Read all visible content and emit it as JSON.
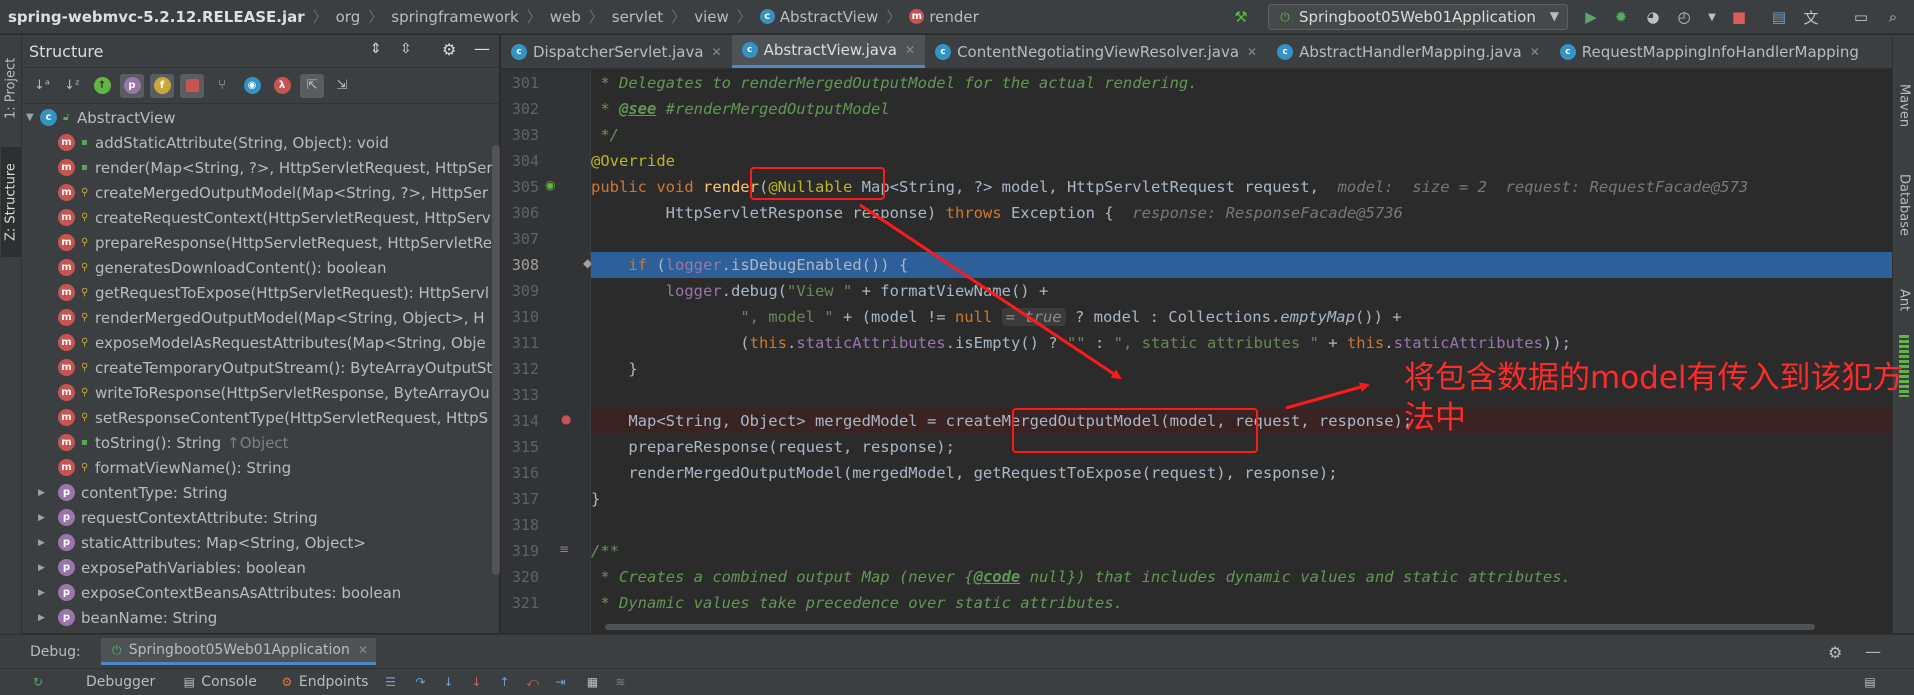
{
  "breadcrumbs": [
    {
      "label": "spring-webmvc-5.2.12.RELEASE.jar",
      "kind": "jar"
    },
    {
      "label": "org",
      "kind": "pkg"
    },
    {
      "label": "springframework",
      "kind": "pkg"
    },
    {
      "label": "web",
      "kind": "pkg"
    },
    {
      "label": "servlet",
      "kind": "pkg"
    },
    {
      "label": "view",
      "kind": "pkg"
    },
    {
      "label": "AbstractView",
      "kind": "class"
    },
    {
      "label": "render",
      "kind": "method"
    }
  ],
  "run_config": {
    "label": "Springboot05Web01Application"
  },
  "left_stripe": {
    "project": "1: Project",
    "structure": "Z: Structure"
  },
  "right_stripe": {
    "maven": "Maven",
    "database": "Database",
    "ant": "Ant"
  },
  "structure": {
    "title": "Structure",
    "root": "AbstractView",
    "members": [
      {
        "icon": "m",
        "vis": "pub",
        "text": "addStaticAttribute(String, Object): void"
      },
      {
        "icon": "m",
        "vis": "pub",
        "text": "render(Map<String, ?>, HttpServletRequest, HttpSer"
      },
      {
        "icon": "m",
        "vis": "prot",
        "text": "createMergedOutputModel(Map<String, ?>, HttpSer"
      },
      {
        "icon": "m",
        "vis": "prot",
        "text": "createRequestContext(HttpServletRequest, HttpServ"
      },
      {
        "icon": "m",
        "vis": "prot",
        "text": "prepareResponse(HttpServletRequest, HttpServletRe"
      },
      {
        "icon": "m",
        "vis": "prot",
        "text": "generatesDownloadContent(): boolean"
      },
      {
        "icon": "m",
        "vis": "prot",
        "text": "getRequestToExpose(HttpServletRequest): HttpServl"
      },
      {
        "icon": "m",
        "vis": "prot",
        "text": "renderMergedOutputModel(Map<String, Object>, H"
      },
      {
        "icon": "m",
        "vis": "prot",
        "text": "exposeModelAsRequestAttributes(Map<String, Obje"
      },
      {
        "icon": "m",
        "vis": "prot",
        "text": "createTemporaryOutputStream(): ByteArrayOutputSt"
      },
      {
        "icon": "m",
        "vis": "prot",
        "text": "writeToResponse(HttpServletResponse, ByteArrayOu"
      },
      {
        "icon": "m",
        "vis": "prot",
        "text": "setResponseContentType(HttpServletRequest, HttpS"
      },
      {
        "icon": "m",
        "vis": "pub",
        "text": "toString(): String",
        "suffix": "↑Object"
      },
      {
        "icon": "m",
        "vis": "prot",
        "text": "formatViewName(): String"
      }
    ],
    "properties": [
      "contentType: String",
      "requestContextAttribute: String",
      "staticAttributes: Map<String, Object>",
      "exposePathVariables: boolean",
      "exposeContextBeansAsAttributes: boolean",
      "beanName: String"
    ]
  },
  "editor_tabs": [
    {
      "label": "DispatcherServlet.java",
      "active": false,
      "close": true
    },
    {
      "label": "AbstractView.java",
      "active": true,
      "close": true
    },
    {
      "label": "ContentNegotiatingViewResolver.java",
      "active": false,
      "close": true
    },
    {
      "label": "AbstractHandlerMapping.java",
      "active": false,
      "close": true
    },
    {
      "label": "RequestMappingInfoHandlerMapping",
      "active": false,
      "close": false
    }
  ],
  "line_numbers": [
    "301",
    "302",
    "303",
    "304",
    "305",
    "306",
    "307",
    "308",
    "309",
    "310",
    "311",
    "312",
    "313",
    "314",
    "315",
    "316",
    "317",
    "318",
    "319",
    "320",
    "321"
  ],
  "code": {
    "l301": " * Delegates to renderMergedOutputModel for the actual rendering.",
    "l302_pre": " * ",
    "l302_tag": "@see",
    "l302_post": " #renderMergedOutputModel",
    "l303": " */",
    "l304": "@Override",
    "l305_kw": "public void ",
    "l305_name": "render",
    "l305_p1": "(",
    "l305_ann": "@Nullable",
    "l305_rest": " Map<String, ?> model, HttpServletRequest request,  ",
    "l305_hint": "model:  size = 2  request: RequestFacade@573",
    "l306_pre": "        HttpServletResponse response) ",
    "l306_kw": "throws",
    "l306_post": " Exception {  ",
    "l306_hint": "response: ResponseFacade@5736",
    "l308_kw": "    if ",
    "l308_p": "(",
    "l308_fld": "logger",
    "l308_post": ".isDebugEnabled()) {",
    "l309_pre": "        ",
    "l309_fld": "logger",
    "l309_mid": ".debug(",
    "l309_str": "\"View \"",
    "l309_post": " + formatViewName() +",
    "l310_pre": "                ",
    "l310_str": "\", model \"",
    "l310_mid": " + (model != ",
    "l310_kw": "null",
    "l310_val": "= true",
    "l310_post": " ? model : Collections.",
    "l310_it": "emptyMap",
    "l310_end": "()) +",
    "l311_pre": "                (",
    "l311_kw1": "this",
    "l311_dot": ".",
    "l311_fld": "staticAttributes",
    "l311_mid": ".isEmpty() ? ",
    "l311_str1": "\"\"",
    "l311_col": " : ",
    "l311_str2": "\", static attributes \"",
    "l311_plus": " + ",
    "l311_kw2": "this",
    "l311_dot2": ".",
    "l311_fld2": "staticAttributes",
    "l311_end": "));",
    "l312": "    }",
    "l314": "    Map<String, Object> mergedModel = createMergedOutputModel(model, request, response);",
    "l315": "    prepareResponse(request, response);",
    "l316": "    renderMergedOutputModel(mergedModel, getRequestToExpose(request), response);",
    "l317": "}",
    "l319": "/**",
    "l320_pre": " * Creates a combined output Map (never {",
    "l320_tag": "@code",
    "l320_post": " null}) that includes dynamic values and static attributes.",
    "l321": " * Dynamic values take precedence over static attributes."
  },
  "annotation": {
    "text": "将包含数据的model有传入到该犯方法中"
  },
  "debug": {
    "label": "Debug:",
    "tab": "Springboot05Web01Application"
  },
  "debug_toolbar": {
    "debugger": "Debugger",
    "console": "Console",
    "endpoints": "Endpoints"
  }
}
